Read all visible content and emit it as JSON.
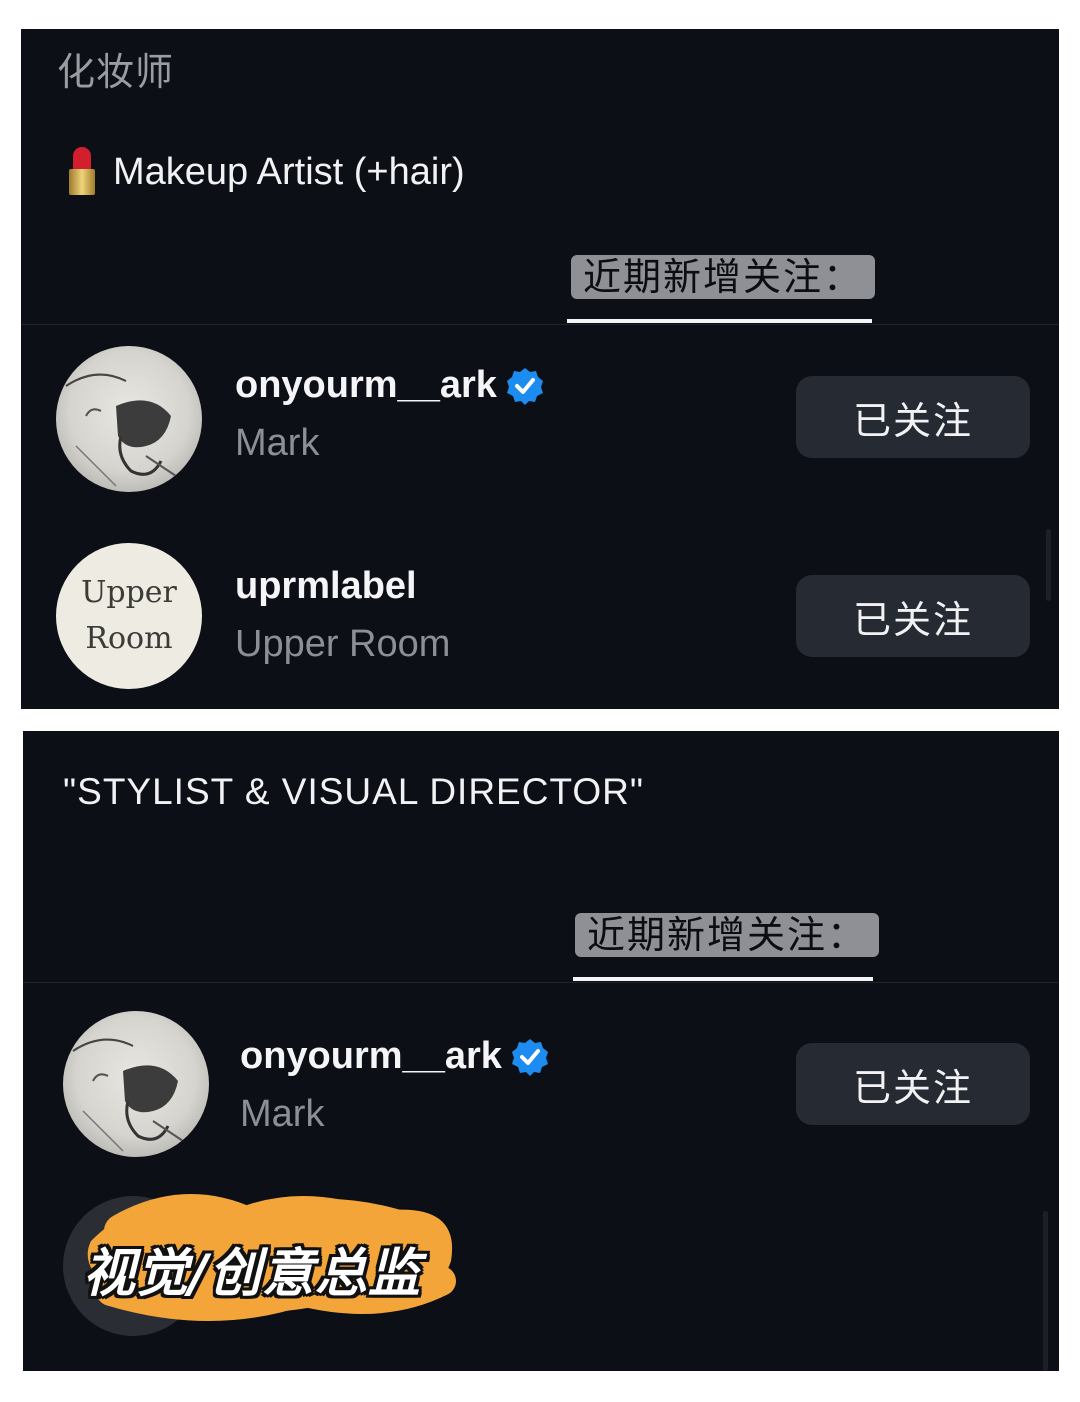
{
  "panel1": {
    "caption": "化妆师",
    "bio_icon": "lipstick-emoji",
    "bio_text": "Makeup Artist (+hair)",
    "recent_label": "近期新增关注：",
    "accounts": [
      {
        "username": "onyourm__ark",
        "name": "Mark",
        "verified": true,
        "avatar": "sketch-portrait",
        "button": "已关注"
      },
      {
        "username": "uprmlabel",
        "name": "Upper Room",
        "verified": false,
        "avatar_line1": "Upper",
        "avatar_line2": "Room",
        "button": "已关注"
      }
    ]
  },
  "panel2": {
    "bio_text": "\"STYLIST & VISUAL DIRECTOR\"",
    "recent_label": "近期新增关注：",
    "accounts": [
      {
        "username": "onyourm__ark",
        "name": "Mark",
        "verified": true,
        "avatar": "sketch-portrait",
        "button": "已关注"
      }
    ],
    "overlay_text": "视觉/创意总监",
    "overlay_color": "#f4a53a"
  },
  "colors": {
    "background": "#0c0f16",
    "button": "#262a33",
    "verified": "#1d8cf0"
  }
}
